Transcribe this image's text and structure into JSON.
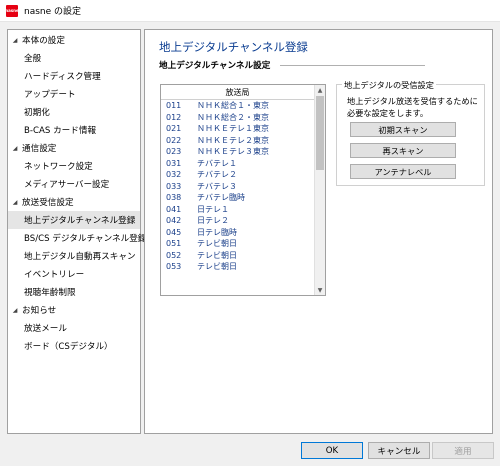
{
  "window": {
    "icon_text": "nasne",
    "title": "nasne の設定"
  },
  "sidebar": {
    "groups": [
      {
        "label": "本体の設定",
        "items": [
          "全般",
          "ハードディスク管理",
          "アップデート",
          "初期化",
          "B-CAS カード情報"
        ]
      },
      {
        "label": "通信設定",
        "items": [
          "ネットワーク設定",
          "メディアサーバー設定"
        ]
      },
      {
        "label": "放送受信設定",
        "items": [
          "地上デジタルチャンネル登録",
          "BS/CS デジタルチャンネル登録",
          "地上デジタル自動再スキャン",
          "イベントリレー",
          "視聴年齢制限"
        ]
      },
      {
        "label": "お知らせ",
        "items": [
          "放送メール",
          "ボード（CSデジタル）"
        ]
      }
    ],
    "selected_item": "地上デジタルチャンネル登録"
  },
  "main": {
    "page_title": "地上デジタルチャンネル登録",
    "section_title": "地上デジタルチャンネル設定",
    "channel_list": {
      "header": "放送局",
      "rows": [
        {
          "number": "011",
          "name": "ＮＨＫ総合１・東京"
        },
        {
          "number": "012",
          "name": "ＮＨＫ総合２・東京"
        },
        {
          "number": "021",
          "name": "ＮＨＫＥテレ１東京"
        },
        {
          "number": "022",
          "name": "ＮＨＫＥテレ２東京"
        },
        {
          "number": "023",
          "name": "ＮＨＫＥテレ３東京"
        },
        {
          "number": "031",
          "name": "チバテレ１"
        },
        {
          "number": "032",
          "name": "チバテレ２"
        },
        {
          "number": "033",
          "name": "チバテレ３"
        },
        {
          "number": "038",
          "name": "チバテレ臨時"
        },
        {
          "number": "041",
          "name": "日テレ１"
        },
        {
          "number": "042",
          "name": "日テレ２"
        },
        {
          "number": "045",
          "name": "日テレ臨時"
        },
        {
          "number": "051",
          "name": "テレビ朝日"
        },
        {
          "number": "052",
          "name": "テレビ朝日"
        },
        {
          "number": "053",
          "name": "テレビ朝日"
        }
      ]
    },
    "reception": {
      "legend": "地上デジタルの受信設定",
      "description": "地上デジタル放送を受信するために必要な設定をします。",
      "initial_scan_label": "初期スキャン",
      "rescan_label": "再スキャン",
      "antenna_level_label": "アンテナレベル"
    }
  },
  "footer": {
    "ok_label": "OK",
    "cancel_label": "キャンセル",
    "apply_label": "適用"
  },
  "colors": {
    "brand": "#e60012",
    "title_blue": "#0b3d91",
    "list_text": "#1a3f8a"
  }
}
